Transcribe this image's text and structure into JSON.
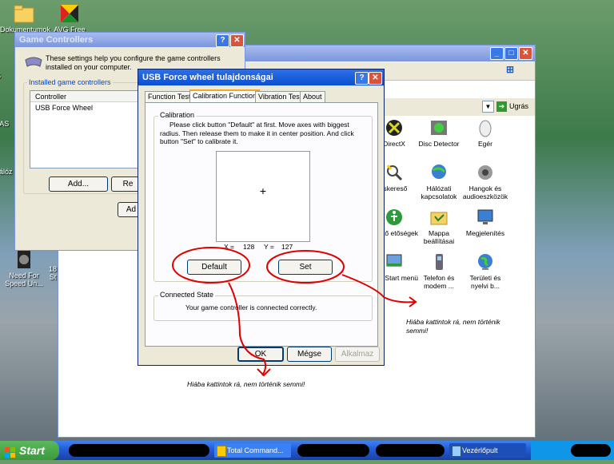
{
  "desktop": {
    "icons": [
      {
        "label": "Dokumentumok",
        "icon": "folder-icon"
      },
      {
        "label": "AVG Free",
        "icon": "avg-icon"
      },
      {
        "label": "Need For Speed Un...",
        "icon": "nfs-icon"
      }
    ],
    "partial_labels": [
      "S",
      "DAS",
      "Hálóz",
      "18",
      "St"
    ]
  },
  "game_controllers": {
    "title": "Game Controllers",
    "description": "These settings help you configure the game controllers installed on your computer.",
    "group_label": "Installed game controllers",
    "column_header": "Controller",
    "rows": [
      "USB Force Wheel"
    ],
    "add_button": "Add...",
    "remove_button": "Re",
    "advanced_button": "Ad"
  },
  "usb_dialog": {
    "title": "USB Force wheel tulajdonságai",
    "tabs": [
      "Function Test",
      "Calibration Function",
      "Vibration Test",
      "About"
    ],
    "selected_tab": 1,
    "calibration_label": "Calibration",
    "instructions": "Please click button \"Default\" at first. Move axes with biggest radius. Then release them to make it in center position. And click button \"Set\" to calibrate it.",
    "crosshair": "+",
    "x_label": "X =",
    "x_value": "128",
    "y_label": "Y =",
    "y_value": "127",
    "default_button": "Default",
    "set_button": "Set",
    "connected_label": "Connected State",
    "connected_text": "Your game controller is connected correctly.",
    "ok_button": "OK",
    "cancel_button": "Mégse",
    "apply_button": "Alkalmaz"
  },
  "control_panel": {
    "title": "Vezérlőpult",
    "go_button": "Ugrás",
    "items": [
      {
        "label": "DirectX",
        "icon": "directx-icon"
      },
      {
        "label": "Disc Detector",
        "icon": "disc-detector-icon"
      },
      {
        "label": "Egér",
        "icon": "mouse-icon"
      },
      {
        "label": "rskereső",
        "icon": "search-icon"
      },
      {
        "label": "Hálózati kapcsolatok",
        "icon": "network-icon"
      },
      {
        "label": "Hangok és audioeszközök",
        "icon": "speaker-icon"
      },
      {
        "label": "segítő etőségek",
        "icon": "accessibility-icon"
      },
      {
        "label": "Mappa beállításai",
        "icon": "folder-options-icon"
      },
      {
        "label": "Megjelenítés",
        "icon": "display-icon"
      },
      {
        "label": "a és Start menü",
        "icon": "taskbar-icon"
      },
      {
        "label": "Telefon és modem ...",
        "icon": "phone-icon"
      },
      {
        "label": "Területi és nyelvi b...",
        "icon": "globe-icon"
      }
    ]
  },
  "annotations": {
    "note1": "Hiába kattintok rá, nem történik semmi!",
    "note2": "Hiába kattintok rá, nem történik semmi!"
  },
  "taskbar": {
    "start": "Start",
    "tasks": [
      "Total Command...",
      "Vezérlőpult"
    ]
  },
  "colors": {
    "annotation_red": "#e00000",
    "title_active": "#0a50d0",
    "window_bg": "#ece9d8"
  }
}
